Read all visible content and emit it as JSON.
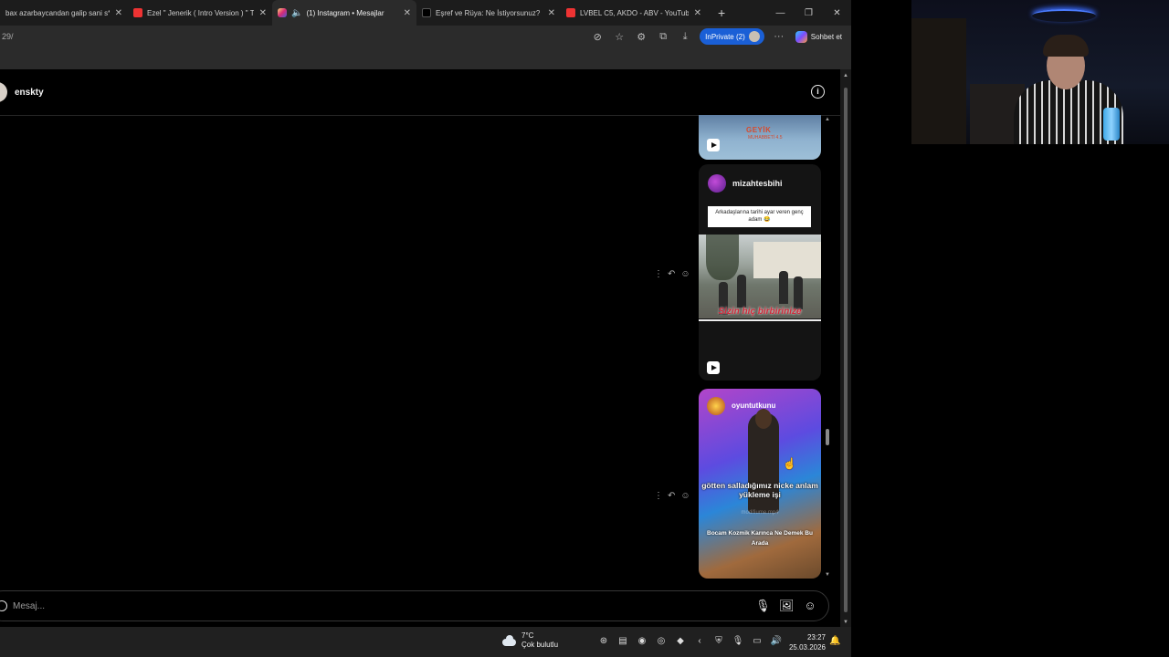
{
  "browser": {
    "tabs": [
      {
        "title": "bax azarbaycandan galip sani s*q",
        "favicon_color": "#1c1c1c"
      },
      {
        "title": "Ezel \" Jenerik ( Intro Version ) \" To",
        "favicon_color": "#e33"
      },
      {
        "title": "(1) Instagram • Mesajlar",
        "favicon_color": "#d62976",
        "active": true,
        "audio": true
      },
      {
        "title": "Eşref ve Rüya: Ne İstiyorsunuz? | Ti",
        "favicon_color": "#111"
      },
      {
        "title": "LVBEL C5, AKDO - ABV - YouTube",
        "favicon_color": "#e33"
      }
    ],
    "url": "29/",
    "inprivate_label": "InPrivate (2)",
    "copilot_label": "Sohbet et"
  },
  "dm": {
    "contact_name": "enskty",
    "messages": [
      {
        "type": "reel-preview-tail",
        "overlay_text": "GEYİK",
        "overlay_sub": "MUHABBETİ 4.5"
      },
      {
        "type": "reel",
        "username": "mizahtesbihi",
        "caption": "Arkadaşlarına tarihi ayar veren genç adam 😂",
        "overlay": "Sizin hiç birbirinize"
      },
      {
        "type": "reel",
        "username": "oyuntutkunu",
        "caption": "götten salladığımız nicke anlam yükleme işi",
        "file": "modifiume.mp4",
        "bottom_text": "Bocam Kozmik Karınca Ne Demek Bu Arada"
      }
    ],
    "composer_placeholder": "Mesaj..."
  },
  "taskbar": {
    "temperature": "7°C",
    "weather": "Çok bulutlu",
    "time": "23:27",
    "date": "25.03.2026"
  }
}
